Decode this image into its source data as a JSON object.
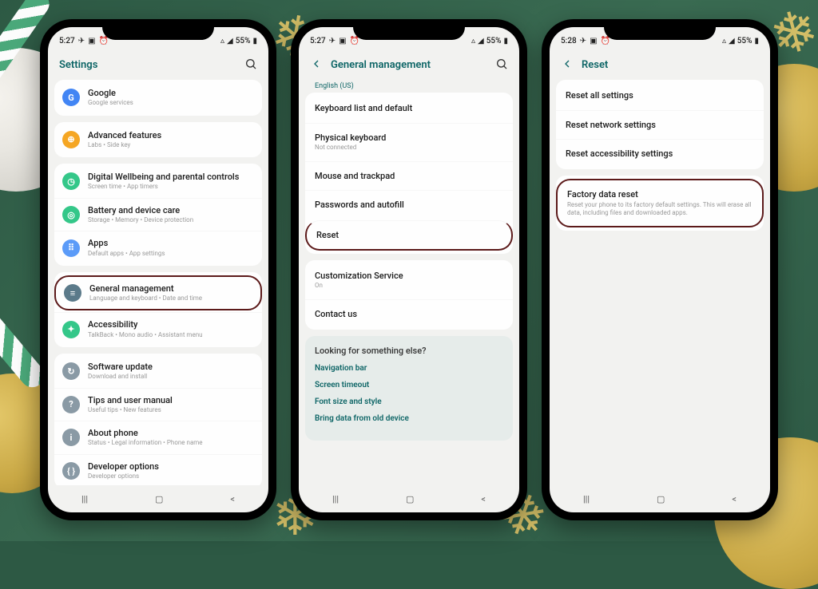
{
  "status": {
    "time1": "5:27",
    "time2": "5:27",
    "time3": "5:28",
    "battery": "55%"
  },
  "phone1": {
    "title": "Settings",
    "groups": [
      [
        {
          "icon": "G",
          "color": "#4285f4",
          "title": "Google",
          "sub": "Google services"
        }
      ],
      [
        {
          "icon": "⊕",
          "color": "#f5a623",
          "title": "Advanced features",
          "sub": "Labs • Side key"
        }
      ],
      [
        {
          "icon": "◷",
          "color": "#34c789",
          "title": "Digital Wellbeing and parental controls",
          "sub": "Screen time • App timers"
        },
        {
          "icon": "◎",
          "color": "#34c789",
          "title": "Battery and device care",
          "sub": "Storage • Memory • Device protection"
        },
        {
          "icon": "⠿",
          "color": "#5b9bf8",
          "title": "Apps",
          "sub": "Default apps • App settings"
        }
      ],
      [
        {
          "icon": "≡",
          "color": "#5b7a8a",
          "title": "General management",
          "sub": "Language and keyboard • Date and time",
          "highlight": true
        },
        {
          "icon": "✦",
          "color": "#34c789",
          "title": "Accessibility",
          "sub": "TalkBack • Mono audio • Assistant menu"
        }
      ],
      [
        {
          "icon": "↻",
          "color": "#8a9aa5",
          "title": "Software update",
          "sub": "Download and install"
        },
        {
          "icon": "?",
          "color": "#8a9aa5",
          "title": "Tips and user manual",
          "sub": "Useful tips • New features"
        },
        {
          "icon": "i",
          "color": "#8a9aa5",
          "title": "About phone",
          "sub": "Status • Legal information • Phone name"
        },
        {
          "icon": "{ }",
          "color": "#8a9aa5",
          "title": "Developer options",
          "sub": "Developer options"
        }
      ]
    ]
  },
  "phone2": {
    "title": "General management",
    "language_link": "English (US)",
    "groups": [
      [
        {
          "title": "Keyboard list and default"
        },
        {
          "title": "Physical keyboard",
          "sub": "Not connected"
        },
        {
          "title": "Mouse and trackpad"
        },
        {
          "title": "Passwords and autofill"
        },
        {
          "title": "Reset",
          "highlight": true
        }
      ],
      [
        {
          "title": "Customization Service",
          "sub": "On"
        },
        {
          "title": "Contact us"
        }
      ]
    ],
    "extras": {
      "title": "Looking for something else?",
      "links": [
        "Navigation bar",
        "Screen timeout",
        "Font size and style",
        "Bring data from old device"
      ]
    }
  },
  "phone3": {
    "title": "Reset",
    "groups": [
      [
        {
          "title": "Reset all settings"
        },
        {
          "title": "Reset network settings"
        },
        {
          "title": "Reset accessibility settings"
        }
      ],
      [
        {
          "title": "Factory data reset",
          "sub": "Reset your phone to its factory default settings. This will erase all data, including files and downloaded apps.",
          "highlight": true
        }
      ]
    ]
  }
}
